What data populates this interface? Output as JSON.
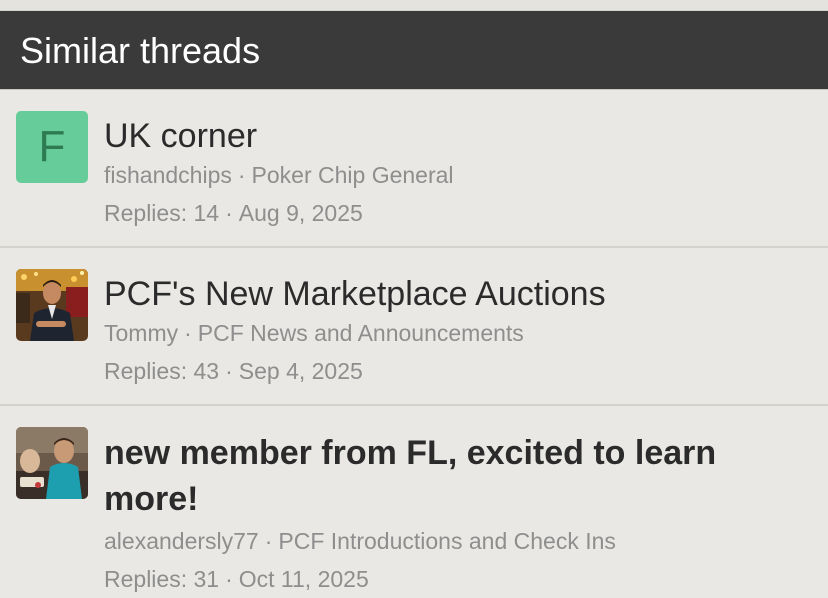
{
  "header": {
    "title": "Similar threads"
  },
  "colors": {
    "header_bg": "#3a3a3a",
    "page_bg": "#e9e8e4",
    "avatar_letter_bg": "#66cc99",
    "meta_text": "#8e8e8e"
  },
  "threads": [
    {
      "avatar_letter": "F",
      "title": "UK corner",
      "author": "fishandchips",
      "forum": "Poker Chip General",
      "replies": "Replies: 14",
      "date": "Aug 9, 2025"
    },
    {
      "title": "PCF's New Marketplace Auctions",
      "author": "Tommy",
      "forum": "PCF News and Announcements",
      "replies": "Replies: 43",
      "date": "Sep 4, 2025"
    },
    {
      "title": "new member from FL, excited to learn more!",
      "author": "alexandersly77",
      "forum": "PCF Introductions and Check Ins",
      "replies": "Replies: 31",
      "date": "Oct 11, 2025"
    }
  ],
  "separator": "·"
}
